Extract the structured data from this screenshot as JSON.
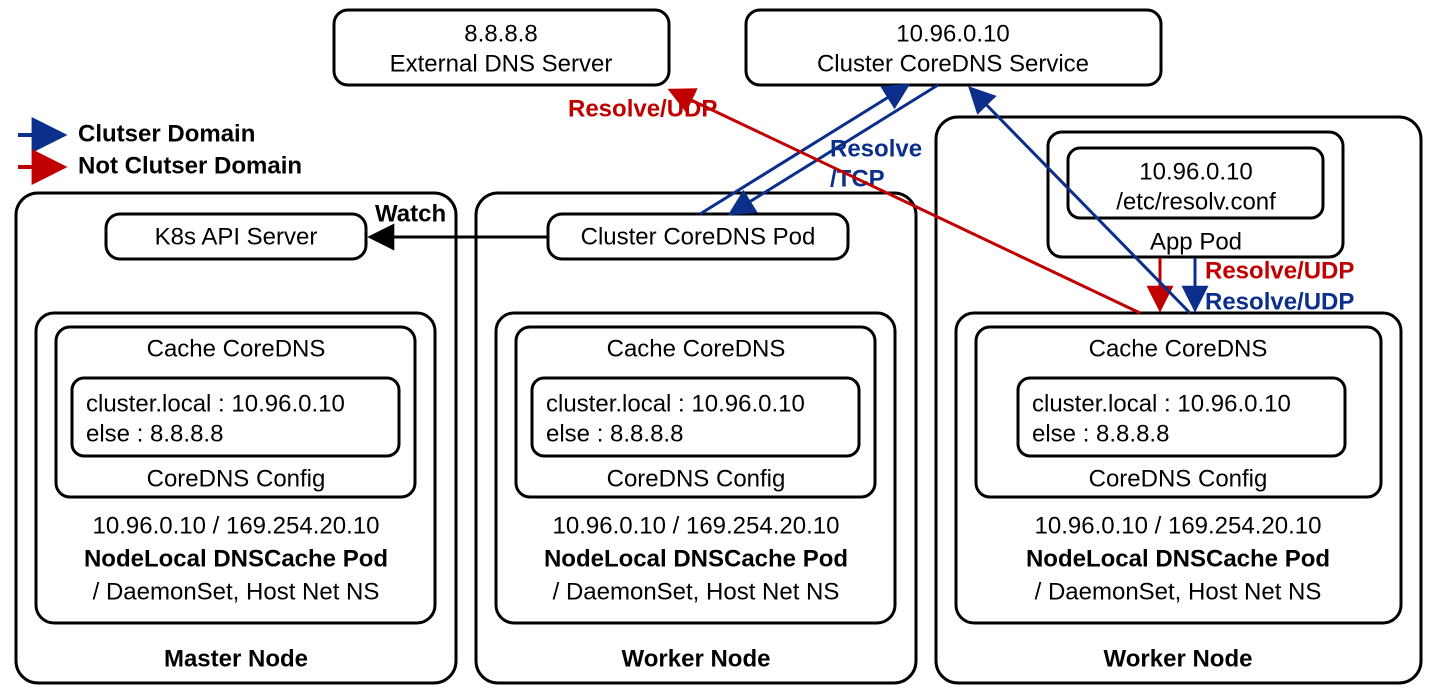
{
  "legend": {
    "cluster": "Clutser Domain",
    "not_cluster": "Not Clutser Domain"
  },
  "external_dns": {
    "ip": "8.8.8.8",
    "label": "External DNS Server"
  },
  "cluster_service": {
    "ip": "10.96.0.10",
    "label": "Cluster CoreDNS Service"
  },
  "api_server": "K8s API Server",
  "cluster_pod": "Cluster CoreDNS Pod",
  "app_pod": {
    "label": "App Pod",
    "resolv_ip": "10.96.0.10",
    "resolv_file": "/etc/resolv.conf"
  },
  "nodelocal": {
    "cache": "Cache CoreDNS",
    "config_line1": "cluster.local : 10.96.0.10",
    "config_line2": "else : 8.8.8.8",
    "config_label": "CoreDNS Config",
    "ips": "10.96.0.10 / 169.254.20.10",
    "pod_name": "NodeLocal DNSCache Pod",
    "pod_sub": "/ DaemonSet, Host Net NS"
  },
  "nodes": {
    "master": "Master Node",
    "worker": "Worker Node"
  },
  "arrows": {
    "watch": "Watch",
    "resolve_tcp0": "Resolve",
    "resolve_tcp1": "/TCP",
    "resolve_udp": "Resolve/UDP"
  },
  "colors": {
    "blue": "#0b2f8a",
    "red": "#c00000"
  }
}
